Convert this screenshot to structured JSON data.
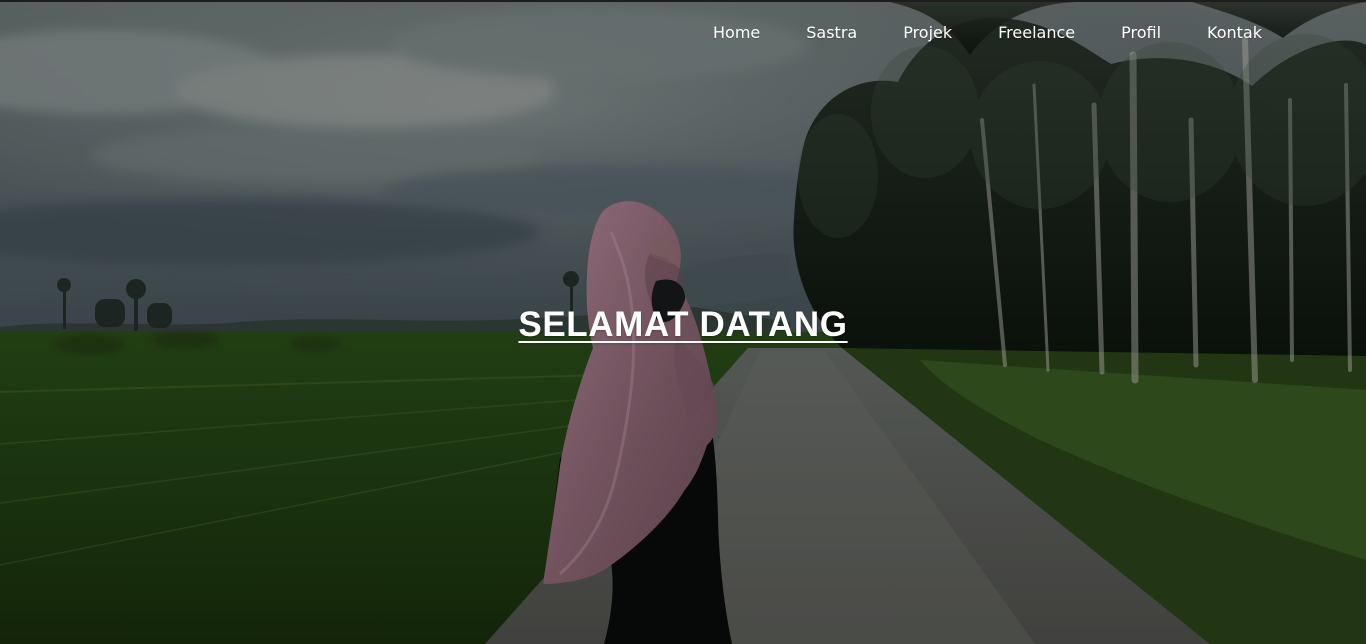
{
  "nav": {
    "items": [
      {
        "label": "Home"
      },
      {
        "label": "Sastra"
      },
      {
        "label": "Projek"
      },
      {
        "label": "Freelance"
      },
      {
        "label": "Profil"
      },
      {
        "label": "Kontak"
      }
    ]
  },
  "hero": {
    "title": "SELAMAT DATANG"
  },
  "colors": {
    "nav_text": "#ffffff",
    "title_text": "#ffffff",
    "overlay": "#000000"
  }
}
